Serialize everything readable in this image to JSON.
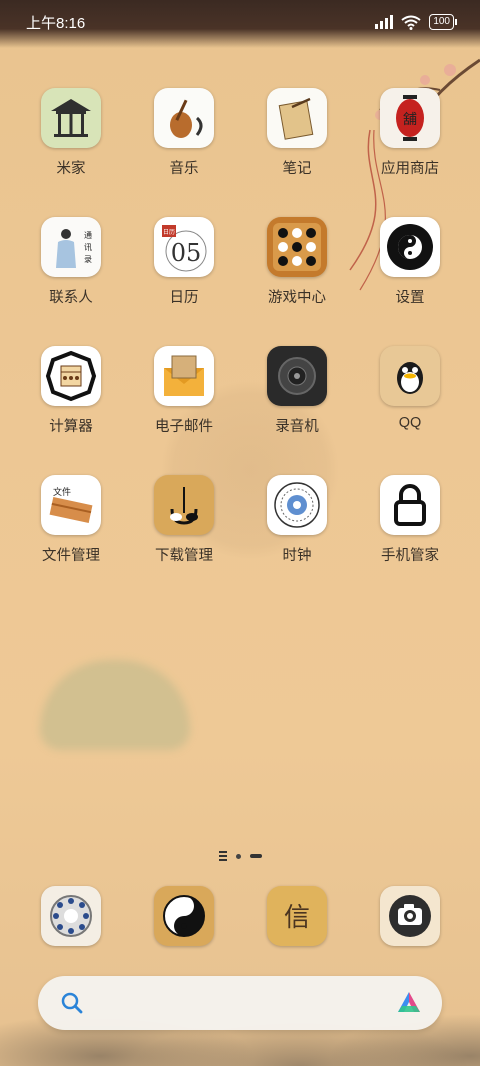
{
  "status_bar": {
    "time": "上午8:16",
    "battery": "100"
  },
  "apps": [
    {
      "label": "米家",
      "icon": "pavilion-icon"
    },
    {
      "label": "音乐",
      "icon": "pipa-icon"
    },
    {
      "label": "笔记",
      "icon": "notebook-icon"
    },
    {
      "label": "应用商店",
      "icon": "lantern-icon"
    },
    {
      "label": "联系人",
      "icon": "scholar-icon"
    },
    {
      "label": "日历",
      "icon": "calendar-icon",
      "day": "05"
    },
    {
      "label": "游戏中心",
      "icon": "go-board-icon"
    },
    {
      "label": "设置",
      "icon": "bagua-icon"
    },
    {
      "label": "计算器",
      "icon": "abacus-icon"
    },
    {
      "label": "电子邮件",
      "icon": "envelope-icon"
    },
    {
      "label": "录音机",
      "icon": "recorder-icon"
    },
    {
      "label": "QQ",
      "icon": "penguin-icon"
    },
    {
      "label": "文件管理",
      "icon": "scroll-icon"
    },
    {
      "label": "下载管理",
      "icon": "download-icon"
    },
    {
      "label": "时钟",
      "icon": "compass-clock-icon"
    },
    {
      "label": "手机管家",
      "icon": "lock-icon"
    }
  ],
  "calendar_badge": "日历",
  "dock": [
    {
      "icon": "rotary-phone-icon"
    },
    {
      "icon": "yin-yang-icon"
    },
    {
      "icon": "letter-icon",
      "glyph": "信"
    },
    {
      "icon": "camera-icon"
    }
  ],
  "page_indicator": {
    "pages": 2,
    "current": 2
  },
  "search": {
    "icon": "search-icon",
    "assistant_icon": "assistant-icon"
  }
}
